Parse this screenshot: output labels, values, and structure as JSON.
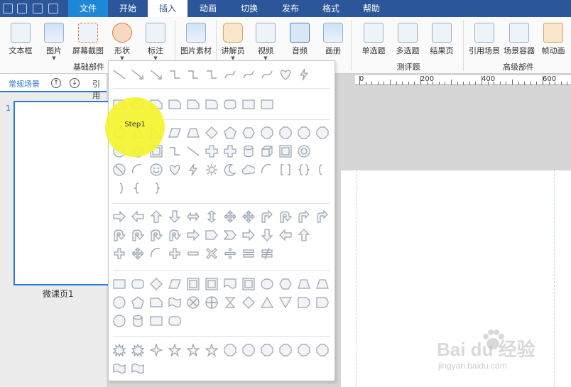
{
  "menu": {
    "tabs": [
      {
        "label": "文件"
      },
      {
        "label": "开始"
      },
      {
        "label": "插入"
      },
      {
        "label": "动画"
      },
      {
        "label": "切换"
      },
      {
        "label": "发布"
      },
      {
        "label": "格式"
      },
      {
        "label": "帮助"
      }
    ],
    "active_tab": "插入"
  },
  "ribbon": {
    "buttons": [
      {
        "label": "文本框",
        "icon": "textbox-icon"
      },
      {
        "label": "图片",
        "icon": "picture-icon",
        "dropdown": true
      },
      {
        "label": "屏幕截图",
        "icon": "screenshot-icon"
      },
      {
        "label": "形状",
        "icon": "shape-icon",
        "dropdown": true
      },
      {
        "label": "标注",
        "icon": "callout-icon",
        "dropdown": true
      },
      {
        "label": "图片素材",
        "icon": "picture-library-icon"
      },
      {
        "label": "讲解员",
        "icon": "presenter-icon",
        "dropdown": true
      },
      {
        "label": "视频",
        "icon": "video-icon",
        "dropdown": true
      },
      {
        "label": "音频",
        "icon": "audio-icon"
      },
      {
        "label": "画册",
        "icon": "album-icon"
      },
      {
        "label": "单选题",
        "icon": "single-choice-icon"
      },
      {
        "label": "多选题",
        "icon": "multi-choice-icon"
      },
      {
        "label": "结果页",
        "icon": "result-page-icon"
      },
      {
        "label": "引用场景",
        "icon": "reference-scene-icon"
      },
      {
        "label": "场景容器",
        "icon": "scene-container-icon"
      },
      {
        "label": "帧动画",
        "icon": "frame-animation-icon"
      }
    ],
    "groups": [
      {
        "label": "基础部件"
      },
      {
        "label": "测评题"
      },
      {
        "label": "高级部件"
      }
    ]
  },
  "left_panel": {
    "scene_tab": "常规场景",
    "up_icon": "up-arrow-icon",
    "down_icon": "down-arrow-icon",
    "reference": "引用",
    "slide_number": "1",
    "slide_name": "微课页1"
  },
  "ruler": {
    "labels": [
      "0",
      "200",
      "400",
      "600"
    ]
  },
  "annotation": {
    "step": "Step1",
    "color": "#f5f530"
  },
  "watermark": {
    "brand": "Bai du 经验",
    "url": "jingyan.baidu.com"
  },
  "colors": {
    "accent": "#2b579a",
    "file_tab": "#1e88d8",
    "selection": "#2b7ad9"
  }
}
